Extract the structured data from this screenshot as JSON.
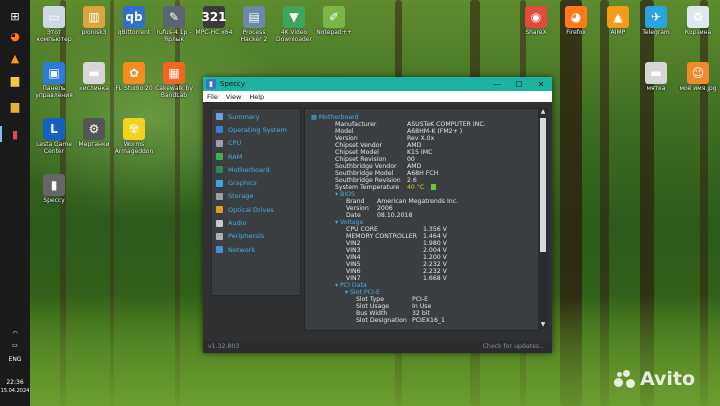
{
  "desktop": {
    "icons": [
      {
        "label": "Этот компьютер",
        "color": "#cfd8e3",
        "glyph": "▭"
      },
      {
        "label": "plonisk3",
        "color": "#d9a441",
        "glyph": "▥"
      },
      {
        "label": "qBittorrent",
        "color": "#2f6fd0",
        "glyph": "qb"
      },
      {
        "label": "rufus-4.1p - Ярлык",
        "color": "#5a6570",
        "glyph": "✎"
      },
      {
        "label": "MPC-HC x64",
        "color": "#3a3a3a",
        "glyph": "321"
      },
      {
        "label": "Process Hacker 2",
        "color": "#6a8aa8",
        "glyph": "▤"
      },
      {
        "label": "4K Video Downloader",
        "color": "#3fa55a",
        "glyph": "▼"
      },
      {
        "label": "Notepad++",
        "color": "#7ab648",
        "glyph": "✐"
      },
      {
        "label": "ShareX",
        "color": "#e24b3b",
        "glyph": "◉"
      },
      {
        "label": "Firefox",
        "color": "#ff7a1a",
        "glyph": "◕"
      },
      {
        "label": "AIMP",
        "color": "#f59b1a",
        "glyph": "▲"
      },
      {
        "label": "Telegram",
        "color": "#2aa3e0",
        "glyph": "✈"
      },
      {
        "label": "Корзина",
        "color": "#dfe8ef",
        "glyph": "♻"
      },
      {
        "label": "Панель управления",
        "color": "#2b7bd8",
        "glyph": "▣"
      },
      {
        "label": "кислинка",
        "color": "#d6d6d6",
        "glyph": "▬"
      },
      {
        "label": "FL Studio 20",
        "color": "#f28c1c",
        "glyph": "✿"
      },
      {
        "label": "Cakewalk by BandLab",
        "color": "#f26522",
        "glyph": "▦"
      },
      {
        "label": "мятка",
        "color": "#d6d6d6",
        "glyph": "▬"
      },
      {
        "label": "моё имя.jpg",
        "color": "#f08a2a",
        "glyph": "☺"
      },
      {
        "label": "Lesta Game Center",
        "color": "#1560c0",
        "glyph": "L"
      },
      {
        "label": "Мерганки",
        "color": "#555555",
        "glyph": "⚙"
      },
      {
        "label": "Worms Armageddon",
        "color": "#f2d21c",
        "glyph": "☢"
      },
      {
        "label": "Speccy",
        "color": "#666666",
        "glyph": "▮"
      }
    ],
    "watermark": "Avito"
  },
  "taskbar": {
    "items": [
      {
        "name": "windows-icon",
        "glyph": "⊞",
        "color": "#ffffff"
      },
      {
        "name": "firefox-icon",
        "glyph": "◕",
        "color": "#ff7a1a"
      },
      {
        "name": "aimp-icon",
        "glyph": "▲",
        "color": "#f59b1a"
      },
      {
        "name": "explorer-icon",
        "glyph": "▆",
        "color": "#f2c744"
      },
      {
        "name": "explorer-alt-icon",
        "glyph": "▆",
        "color": "#e0b43a"
      },
      {
        "name": "speccy-icon",
        "glyph": "▮",
        "color": "#e04a4a"
      }
    ],
    "lang": "ENG",
    "time": "22:36",
    "date": "15.04.2024"
  },
  "window": {
    "title": "Speccy",
    "menu": [
      "File",
      "View",
      "Help"
    ],
    "controls": [
      "—",
      "☐",
      "✕"
    ],
    "nav": [
      {
        "label": "Summary",
        "color": "#6fa0d8"
      },
      {
        "label": "Operating System",
        "color": "#3a7fd0"
      },
      {
        "label": "CPU",
        "color": "#9aa0a6"
      },
      {
        "label": "RAM",
        "color": "#3fb24a"
      },
      {
        "label": "Motherboard",
        "color": "#2e8b57"
      },
      {
        "label": "Graphics",
        "color": "#3fa5e0"
      },
      {
        "label": "Storage",
        "color": "#9aa0a6"
      },
      {
        "label": "Optical Drives",
        "color": "#d8a030"
      },
      {
        "label": "Audio",
        "color": "#c8c8c8"
      },
      {
        "label": "Peripherals",
        "color": "#b0b0b0"
      },
      {
        "label": "Network",
        "color": "#4a90d0"
      }
    ],
    "motherboard": {
      "heading": "Motherboard",
      "fields": [
        {
          "k": "Manufacturer",
          "v": "ASUSTeK COMPUTER INC."
        },
        {
          "k": "Model",
          "v": "A68HM-K (FM2+ )"
        },
        {
          "k": "Version",
          "v": "Rev X.0x"
        },
        {
          "k": "Chipset Vendor",
          "v": "AMD"
        },
        {
          "k": "Chipset Model",
          "v": "K15 IMC"
        },
        {
          "k": "Chipset Revision",
          "v": "00"
        },
        {
          "k": "Southbridge Vendor",
          "v": "AMD"
        },
        {
          "k": "Southbridge Model",
          "v": "A68H FCH"
        },
        {
          "k": "Southbridge Revision",
          "v": "2.6"
        },
        {
          "k": "System Temperature",
          "v": "40 °C"
        }
      ],
      "bios_heading": "BIOS",
      "bios": [
        {
          "k": "Brand",
          "v": "American Megatrends Inc."
        },
        {
          "k": "Version",
          "v": "2006"
        },
        {
          "k": "Date",
          "v": "08.10.2018"
        }
      ],
      "voltage_heading": "Voltage",
      "voltage": [
        {
          "k": "CPU CORE",
          "v": "1.356 V"
        },
        {
          "k": "MEMORY CONTROLLER",
          "v": "1.464 V"
        },
        {
          "k": "VIN2",
          "v": "1.980 V"
        },
        {
          "k": "VIN3",
          "v": "2.004 V"
        },
        {
          "k": "VIN4",
          "v": "1.200 V"
        },
        {
          "k": "VIN5",
          "v": "2.232 V"
        },
        {
          "k": "VIN6",
          "v": "2.232 V"
        },
        {
          "k": "VIN7",
          "v": "1.668 V"
        }
      ],
      "pci_heading": "PCI Data",
      "slot_heading": "Slot PCI-E",
      "slot": [
        {
          "k": "Slot Type",
          "v": "PCI-E"
        },
        {
          "k": "Slot Usage",
          "v": "In Use"
        },
        {
          "k": "Bus Width",
          "v": "32 bit"
        },
        {
          "k": "Slot Designation",
          "v": "PCIEX16_1"
        }
      ]
    },
    "version": "v1.32.803",
    "update": "Check for updates..."
  }
}
